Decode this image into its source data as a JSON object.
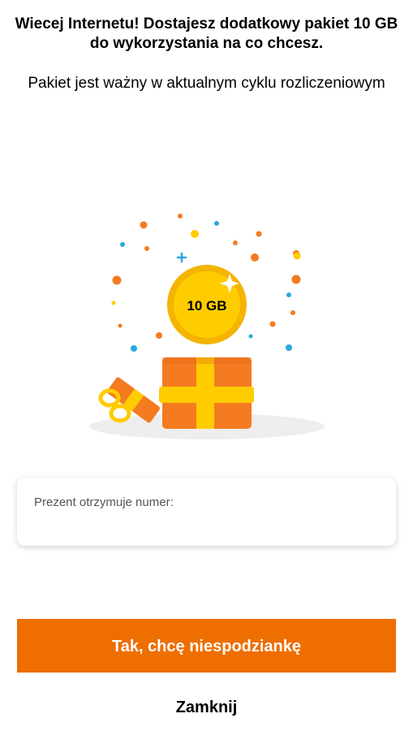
{
  "header": {
    "title": "Wiecej Internetu! Dostajesz dodatkowy pakiet 10 GB do wykorzystania na co chcesz.",
    "subtitle": "Pakiet jest ważny w aktualnym cyklu rozliczeniowym"
  },
  "illustration": {
    "coin_label": "10 GB",
    "colors": {
      "orange": "#f47b20",
      "gold": "#ffcc00",
      "blue": "#2aa8e0",
      "shadow": "#eeeeee"
    }
  },
  "recipient": {
    "label": "Prezent otrzymuje numer:",
    "value": ""
  },
  "actions": {
    "confirm_label": "Tak, chcę niespodziankę",
    "close_label": "Zamknij"
  },
  "theme": {
    "accent": "#ee6e00"
  }
}
